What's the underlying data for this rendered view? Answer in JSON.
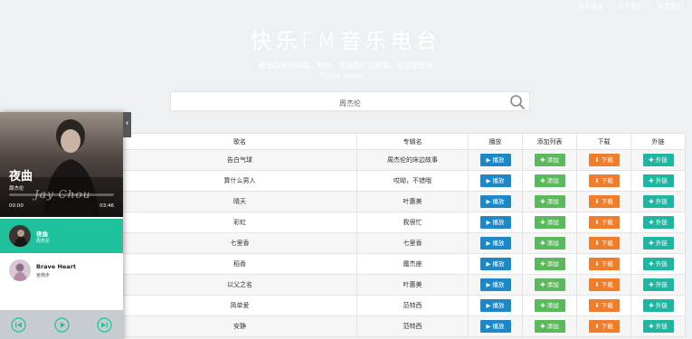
{
  "topnav": [
    "音乐电台",
    "关于我们",
    "联系我们"
  ],
  "site": {
    "title": "快乐FM音乐电台",
    "subtitle1": "给你简单的好歌，有时，就是我们的故事。在这里发现",
    "subtitle2": "Enjoy music..."
  },
  "search": {
    "placeholder": "周杰伦",
    "value": "周杰伦"
  },
  "table": {
    "headers": [
      "歌名",
      "专辑名",
      "播放",
      "添加列表",
      "下载",
      "外链"
    ],
    "rows": [
      {
        "song": "告白气球",
        "album": "周杰伦的床边故事"
      },
      {
        "song": "算什么男人",
        "album": "哎呦，不错哦"
      },
      {
        "song": "晴天",
        "album": "叶惠美"
      },
      {
        "song": "彩虹",
        "album": "我很忙"
      },
      {
        "song": "七里香",
        "album": "七里香"
      },
      {
        "song": "稻香",
        "album": "魔杰座"
      },
      {
        "song": "以父之名",
        "album": "叶惠美"
      },
      {
        "song": "简单爱",
        "album": "范特西"
      },
      {
        "song": "安静",
        "album": "范特西"
      }
    ],
    "actions": {
      "play": "▶ 播放",
      "add": "✚ 添加",
      "download": "⬇ 下载",
      "link": "✚ 外链"
    }
  },
  "player": {
    "title": "夜曲",
    "artist": "周杰伦",
    "signature": "Jay Chou",
    "current_time": "00:00",
    "total_time": "03:46",
    "progress": 0,
    "playlist": [
      {
        "name": "夜曲",
        "artist": "周杰伦",
        "active": true
      },
      {
        "name": "Brave Heart",
        "artist": "宫崎步",
        "active": false
      }
    ]
  },
  "colors": {
    "page_bg": "#eef1f3",
    "play": "#1e88c7",
    "add": "#5cb85c",
    "download": "#ef7d2b",
    "link": "#1fb5a0",
    "playlist_active": "#1fc19c"
  }
}
